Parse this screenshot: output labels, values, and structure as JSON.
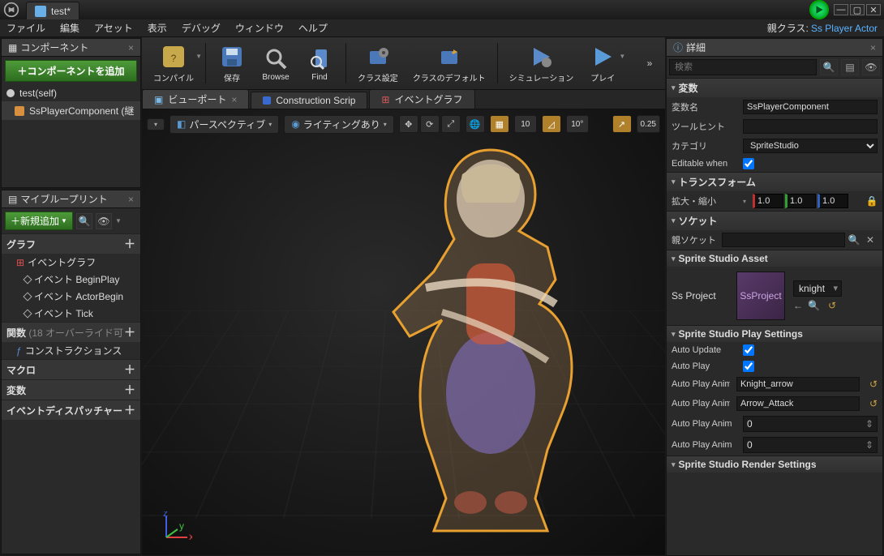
{
  "title_tab": "test*",
  "menubar": [
    "ファイル",
    "編集",
    "アセット",
    "表示",
    "デバッグ",
    "ウィンドウ",
    "ヘルプ"
  ],
  "parent_class_label": "親クラス:",
  "parent_class_link": "Ss Player Actor",
  "components": {
    "tab": "コンポーネント",
    "add_btn": "＋コンポーネントを追加",
    "root": "test(self)",
    "child": "SsPlayerComponent (継"
  },
  "mybp": {
    "tab": "マイブループリント",
    "add_btn": "＋新規追加",
    "graph_head": "グラフ",
    "event_graph": "イベントグラフ",
    "events": [
      "イベント BeginPlay",
      "イベント ActorBegin",
      "イベント Tick"
    ],
    "functions_head": "関数",
    "functions_note": "(18 オーバーライド可",
    "construction": "コンストラクションス",
    "macros_head": "マクロ",
    "vars_head": "変数",
    "dispatchers_head": "イベントディスパッチャー"
  },
  "toolbar": {
    "compile": "コンパイル",
    "save": "保存",
    "browse": "Browse",
    "find": "Find",
    "class_settings": "クラス設定",
    "class_defaults": "クラスのデフォルト",
    "simulate": "シミュレーション",
    "play": "プレイ"
  },
  "vp_tabs": {
    "viewport": "ビューポート",
    "construction": "Construction Scrip",
    "eventgraph": "イベントグラフ"
  },
  "vp_toolbar": {
    "perspective": "パースペクティブ",
    "lit": "ライティングあり",
    "snap_grid": "10",
    "snap_angle": "10°",
    "snap_scale": "0.25"
  },
  "details": {
    "tab": "詳細",
    "search_placeholder": "検索",
    "sec_vars": "変数",
    "var_name_lbl": "変数名",
    "var_name_val": "SsPlayerComponent",
    "tooltip_lbl": "ツールヒント",
    "tooltip_val": "",
    "category_lbl": "カテゴリ",
    "category_val": "SpriteStudio",
    "editable_lbl": "Editable when",
    "editable_val": true,
    "sec_transform": "トランスフォーム",
    "scale_lbl": "拡大・縮小",
    "scale_x": "1.0",
    "scale_y": "1.0",
    "scale_z": "1.0",
    "sec_socket": "ソケット",
    "parent_socket_lbl": "親ソケット",
    "parent_socket_val": "",
    "sec_asset": "Sprite Studio Asset",
    "ssproject_lbl": "Ss Project",
    "asset_thumb_text": "SsProject",
    "asset_name": "knight",
    "sec_play": "Sprite Studio Play Settings",
    "auto_update_lbl": "Auto Update",
    "auto_update_val": true,
    "auto_play_lbl": "Auto Play",
    "auto_play_val": true,
    "auto_anim1_lbl": "Auto Play Anim",
    "auto_anim1_val": "Knight_arrow",
    "auto_anim2_lbl": "Auto Play Anim",
    "auto_anim2_val": "Arrow_Attack",
    "auto_anim3_lbl": "Auto Play Anim",
    "auto_anim3_val": "0",
    "auto_anim4_lbl": "Auto Play Anim",
    "auto_anim4_val": "0",
    "sec_render": "Sprite Studio Render Settings"
  }
}
